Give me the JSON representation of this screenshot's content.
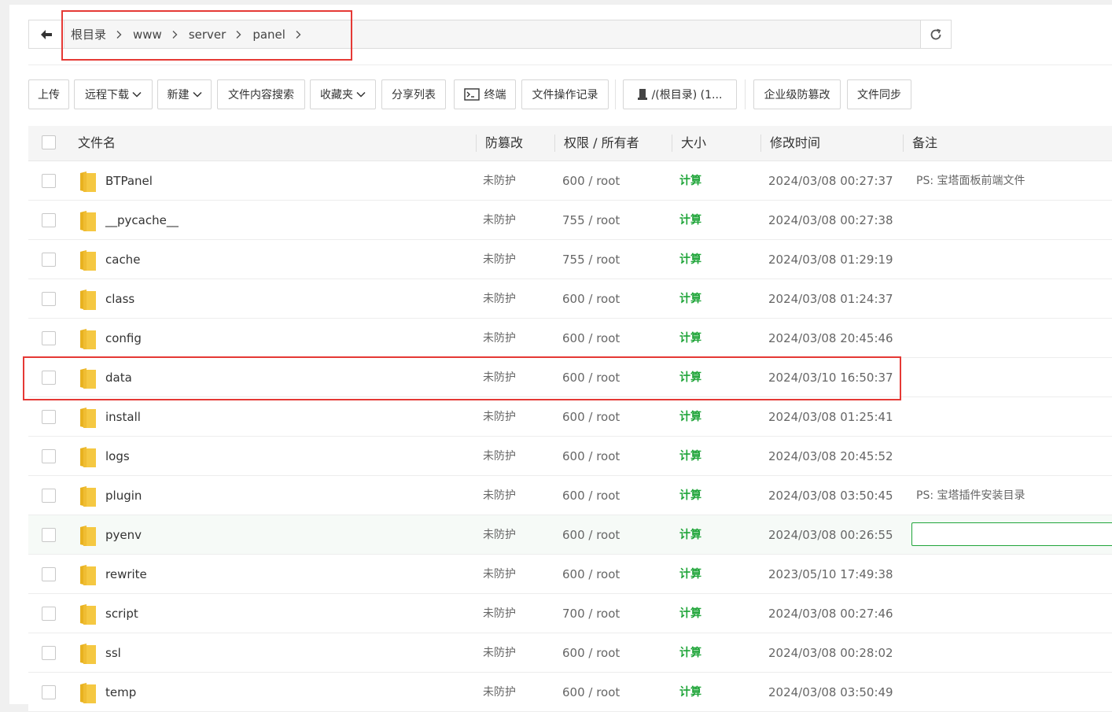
{
  "breadcrumb": {
    "items": [
      "根目录",
      "www",
      "server",
      "panel"
    ]
  },
  "toolbar": {
    "upload": "上传",
    "remote_download": "远程下载",
    "new": "新建",
    "content_search": "文件内容搜索",
    "favorites": "收藏夹",
    "share_list": "分享列表",
    "terminal": "终端",
    "operation_log": "文件操作记录",
    "disk": "/(根目录) (1...",
    "tamper_proof": "企业级防篡改",
    "file_sync": "文件同步"
  },
  "table": {
    "headers": {
      "name": "文件名",
      "protect": "防篡改",
      "perm": "权限 / 所有者",
      "size": "大小",
      "mtime": "修改时间",
      "note": "备注"
    },
    "rows": [
      {
        "name": "BTPanel",
        "protect": "未防护",
        "perm": "600 / root",
        "size": "计算",
        "mtime": "2024/03/08 00:27:37",
        "note": "PS: 宝塔面板前端文件"
      },
      {
        "name": "__pycache__",
        "protect": "未防护",
        "perm": "755 / root",
        "size": "计算",
        "mtime": "2024/03/08 00:27:38",
        "note": ""
      },
      {
        "name": "cache",
        "protect": "未防护",
        "perm": "755 / root",
        "size": "计算",
        "mtime": "2024/03/08 01:29:19",
        "note": ""
      },
      {
        "name": "class",
        "protect": "未防护",
        "perm": "600 / root",
        "size": "计算",
        "mtime": "2024/03/08 01:24:37",
        "note": ""
      },
      {
        "name": "config",
        "protect": "未防护",
        "perm": "600 / root",
        "size": "计算",
        "mtime": "2024/03/08 20:45:46",
        "note": ""
      },
      {
        "name": "data",
        "protect": "未防护",
        "perm": "600 / root",
        "size": "计算",
        "mtime": "2024/03/10 16:50:37",
        "note": ""
      },
      {
        "name": "install",
        "protect": "未防护",
        "perm": "600 / root",
        "size": "计算",
        "mtime": "2024/03/08 01:25:41",
        "note": ""
      },
      {
        "name": "logs",
        "protect": "未防护",
        "perm": "600 / root",
        "size": "计算",
        "mtime": "2024/03/08 20:45:52",
        "note": ""
      },
      {
        "name": "plugin",
        "protect": "未防护",
        "perm": "600 / root",
        "size": "计算",
        "mtime": "2024/03/08 03:50:45",
        "note": "PS: 宝塔插件安装目录"
      },
      {
        "name": "pyenv",
        "protect": "未防护",
        "perm": "600 / root",
        "size": "计算",
        "mtime": "2024/03/08 00:26:55",
        "note": ""
      },
      {
        "name": "rewrite",
        "protect": "未防护",
        "perm": "600 / root",
        "size": "计算",
        "mtime": "2023/05/10 17:49:38",
        "note": ""
      },
      {
        "name": "script",
        "protect": "未防护",
        "perm": "700 / root",
        "size": "计算",
        "mtime": "2024/03/08 00:27:46",
        "note": ""
      },
      {
        "name": "ssl",
        "protect": "未防护",
        "perm": "600 / root",
        "size": "计算",
        "mtime": "2024/03/08 00:28:02",
        "note": ""
      },
      {
        "name": "temp",
        "protect": "未防护",
        "perm": "600 / root",
        "size": "计算",
        "mtime": "2024/03/08 03:50:49",
        "note": ""
      }
    ],
    "hover_row_index": 9,
    "editing_note_row_index": 9,
    "editing_note_value": ""
  },
  "icons": {
    "back": "arrow-left-icon",
    "refresh": "refresh-icon",
    "chevron": "chevron-right-icon",
    "dropdown": "chevron-down-icon",
    "terminal": "terminal-icon",
    "disk": "disk-icon",
    "folder": "folder-icon"
  },
  "colors": {
    "accent_green": "#20a53a",
    "highlight_red": "#e53935",
    "folder_yellow": "#f5c842"
  }
}
